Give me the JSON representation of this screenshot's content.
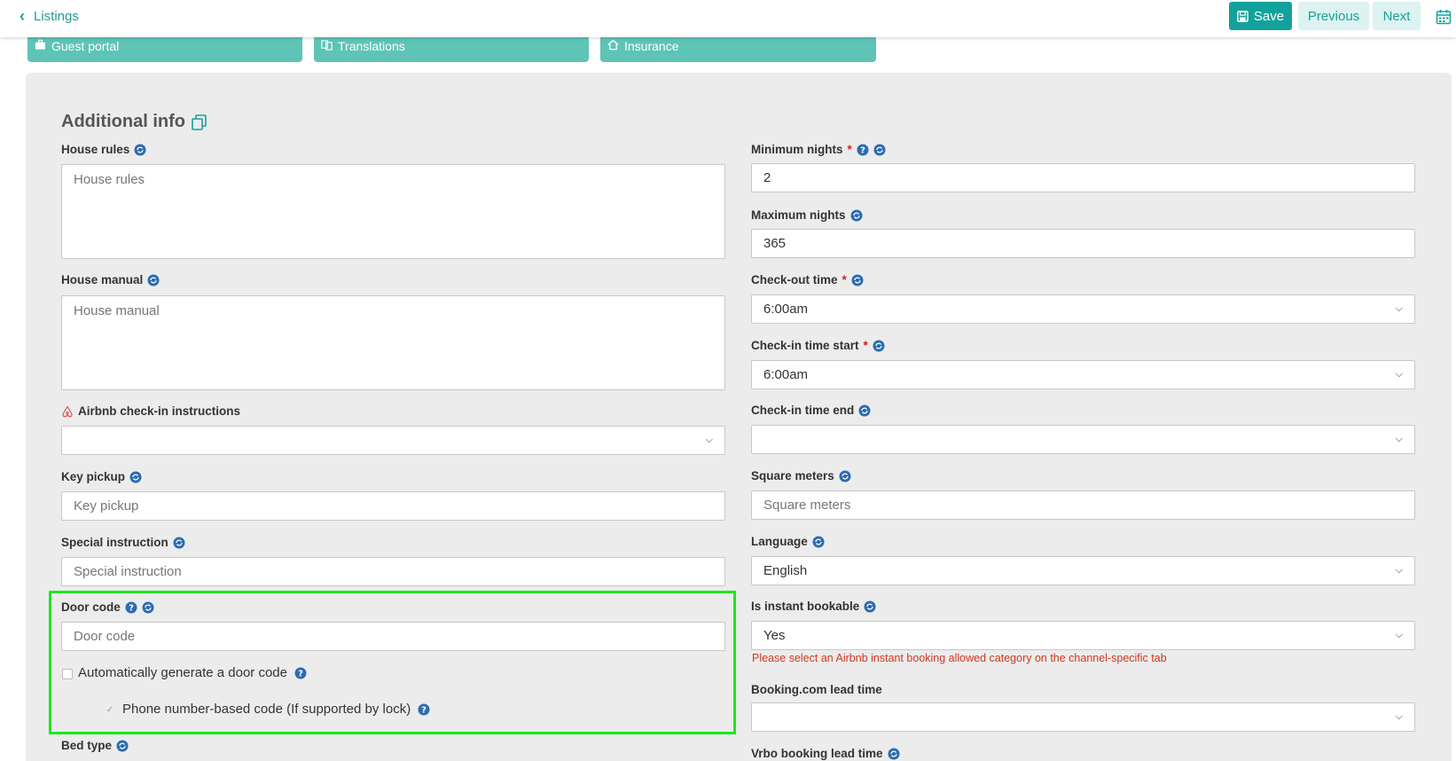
{
  "topbar": {
    "back_label": "Listings",
    "save_label": "Save",
    "previous_label": "Previous",
    "next_label": "Next"
  },
  "tabs": [
    "Guest portal",
    "Translations",
    "Insurance"
  ],
  "section": {
    "title": "Additional info"
  },
  "left": {
    "house_rules": {
      "label": "House rules",
      "placeholder": "House rules"
    },
    "house_manual": {
      "label": "House manual",
      "placeholder": "House manual"
    },
    "airbnb_checkin": {
      "label": "Airbnb check-in instructions",
      "value": ""
    },
    "key_pickup": {
      "label": "Key pickup",
      "placeholder": "Key pickup"
    },
    "special_instruction": {
      "label": "Special instruction",
      "placeholder": "Special instruction"
    },
    "door_code": {
      "label": "Door code",
      "placeholder": "Door code",
      "auto_generate_label": "Automatically generate a door code",
      "phone_based_label": "Phone number-based code (If supported by lock)"
    },
    "bed_type": {
      "label": "Bed type"
    }
  },
  "right": {
    "minimum_nights": {
      "label": "Minimum nights",
      "value": "2"
    },
    "maximum_nights": {
      "label": "Maximum nights",
      "value": "365"
    },
    "checkout_time": {
      "label": "Check-out time",
      "value": "6:00am"
    },
    "checkin_start": {
      "label": "Check-in time start",
      "value": "6:00am"
    },
    "checkin_end": {
      "label": "Check-in time end",
      "value": ""
    },
    "square_meters": {
      "label": "Square meters",
      "placeholder": "Square meters"
    },
    "language": {
      "label": "Language",
      "value": "English"
    },
    "instant_bookable": {
      "label": "Is instant bookable",
      "value": "Yes",
      "error": "Please select an Airbnb instant booking allowed category on the channel-specific tab"
    },
    "booking_lead_time": {
      "label": "Booking.com lead time",
      "value": ""
    },
    "vrbo_lead_time": {
      "label": "Vrbo booking lead time"
    }
  },
  "colors": {
    "accent": "#13a29b",
    "tab": "#5ec4b5",
    "help_icon": "#2b6cb0",
    "required": "#d02020",
    "error": "#d0381e",
    "highlight": "#1be81b"
  },
  "icons": [
    "chevron-left-icon",
    "save-icon",
    "calendar-icon",
    "briefcase-icon",
    "translate-icon",
    "home-icon",
    "copy-icon",
    "help-icon",
    "sync-icon",
    "airbnb-icon",
    "check-icon"
  ]
}
